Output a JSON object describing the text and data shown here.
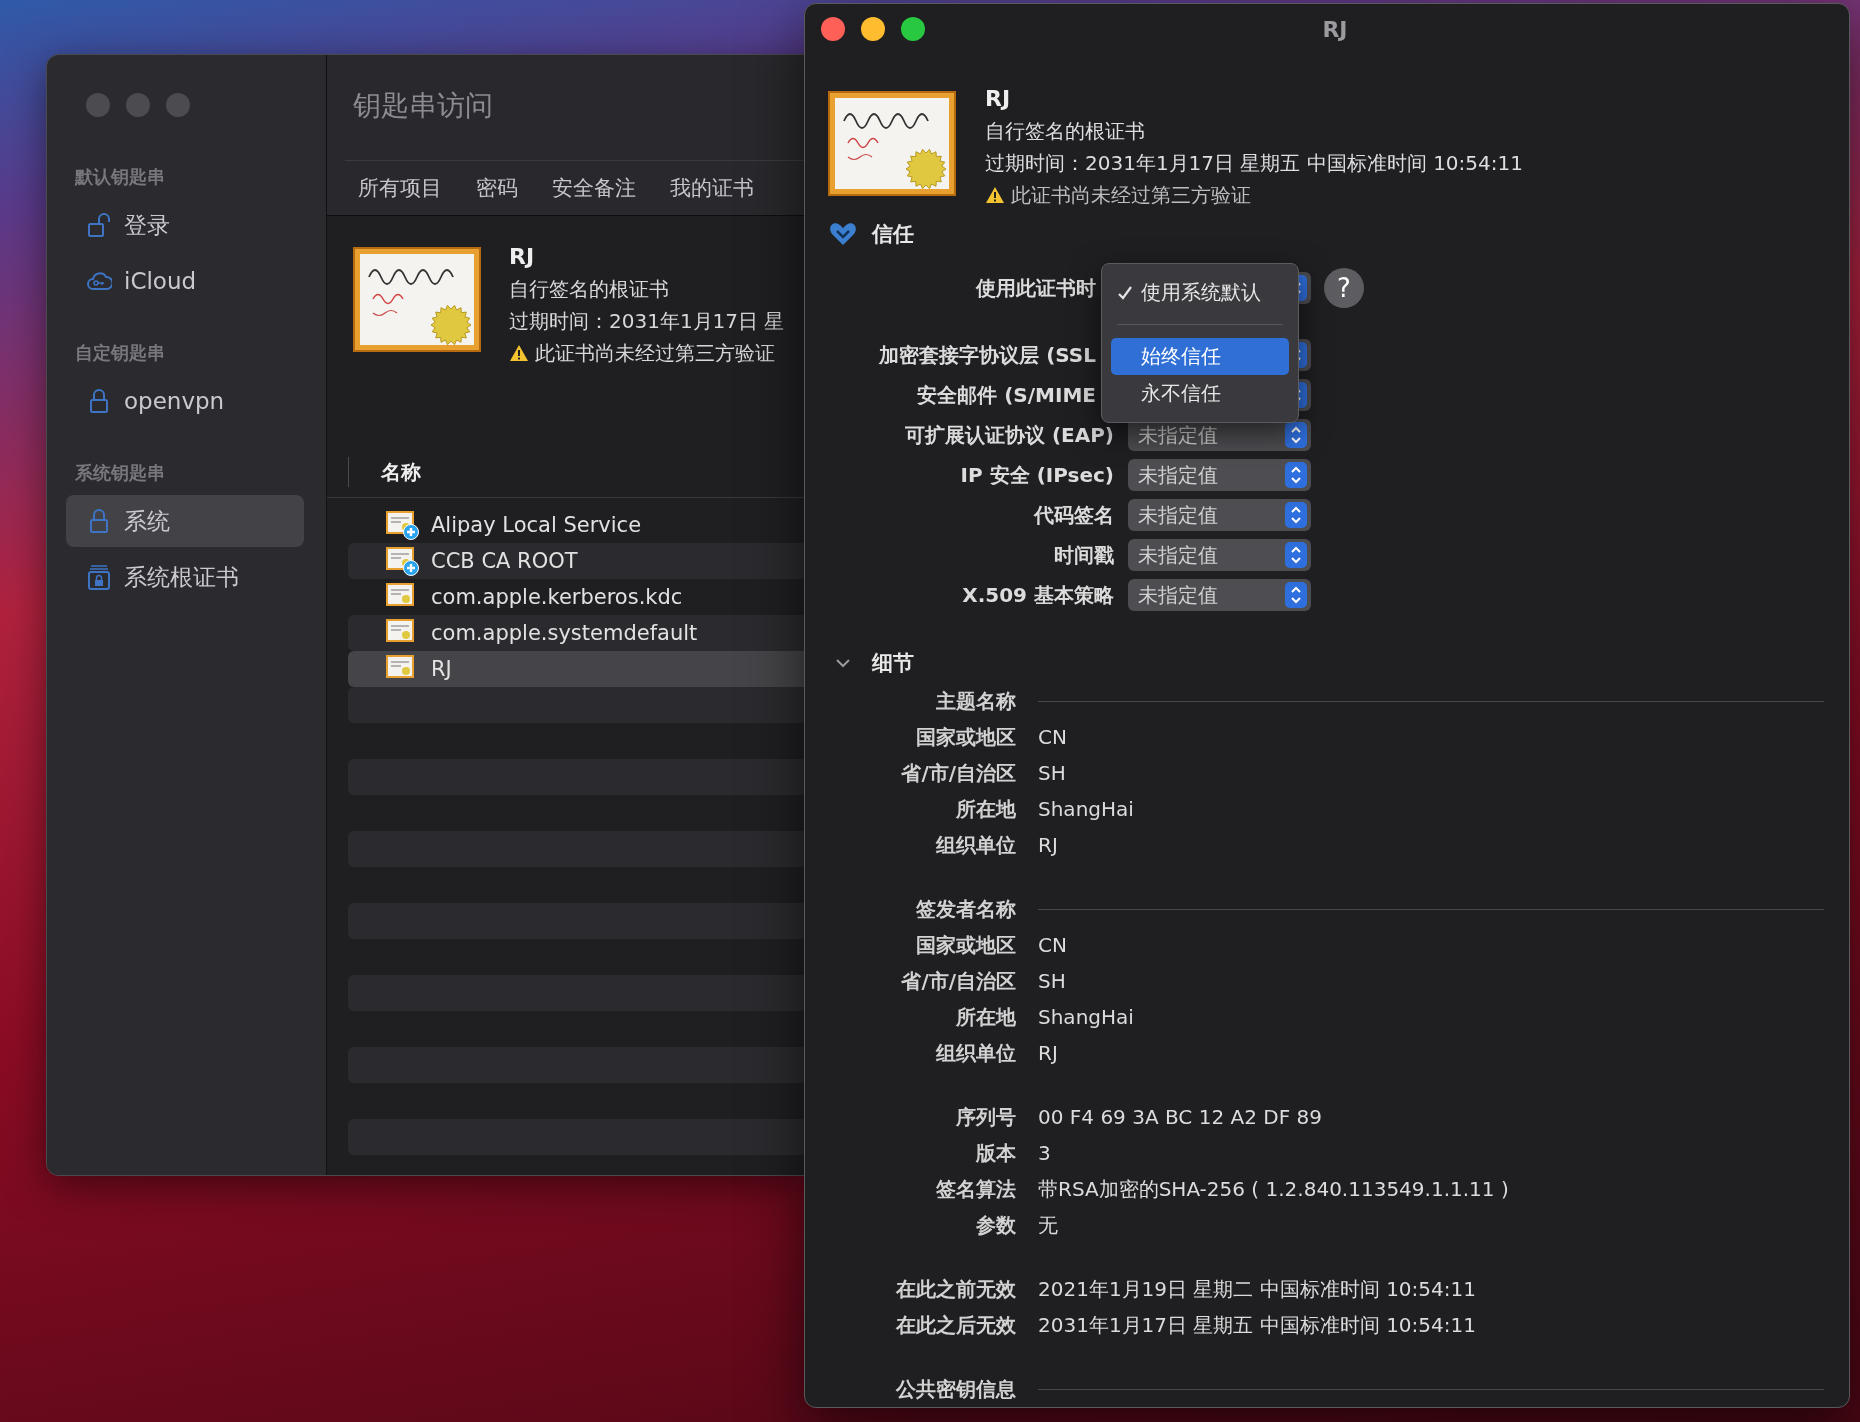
{
  "keychain_window": {
    "title": "钥匙串访问",
    "sidebar": [
      {
        "header": "默认钥匙串",
        "items": [
          {
            "label": "登录",
            "kind": "unlocked",
            "selected": false
          },
          {
            "label": "iCloud",
            "kind": "cloud",
            "selected": false
          }
        ]
      },
      {
        "header": "自定钥匙串",
        "items": [
          {
            "label": "openvpn",
            "kind": "locked",
            "selected": false
          }
        ]
      },
      {
        "header": "系统钥匙串",
        "items": [
          {
            "label": "系统",
            "kind": "locked",
            "selected": true
          },
          {
            "label": "系统根证书",
            "kind": "vault",
            "selected": false
          }
        ]
      }
    ],
    "tabs": [
      {
        "label": "所有项目",
        "selected": false
      },
      {
        "label": "密码",
        "selected": false
      },
      {
        "label": "安全备注",
        "selected": false
      },
      {
        "label": "我的证书",
        "selected": false
      }
    ],
    "summary": {
      "name": "RJ",
      "type": "自行签名的根证书",
      "expires": "过期时间：2031年1月17日 星",
      "warning": "此证书尚未经过第三方验证"
    },
    "table": {
      "columns": [
        "名称"
      ],
      "rows": [
        {
          "name": "Alipay Local Service",
          "kind": "added",
          "selected": false
        },
        {
          "name": "CCB CA ROOT",
          "kind": "added",
          "selected": false
        },
        {
          "name": "com.apple.kerberos.kdc",
          "kind": "plain",
          "selected": false
        },
        {
          "name": "com.apple.systemdefault",
          "kind": "plain",
          "selected": false
        },
        {
          "name": "RJ",
          "kind": "plain",
          "selected": true
        }
      ]
    }
  },
  "certificate_window": {
    "title": "RJ",
    "summary": {
      "name": "RJ",
      "type": "自行签名的根证书",
      "expires": "过期时间：2031年1月17日 星期五 中国标准时间 10:54:11",
      "warning": "此证书尚未经过第三方验证"
    },
    "trust": {
      "heading": "信任",
      "expanded": true,
      "help_button": "?",
      "rows": [
        {
          "label": "使用此证书时"
        },
        {
          "label": "加密套接字协议层 (SSL"
        },
        {
          "label": "安全邮件 (S/MIME"
        },
        {
          "label": "可扩展认证协议 (EAP)",
          "value": "未指定值"
        },
        {
          "label": "IP 安全 (IPsec)",
          "value": "未指定值"
        },
        {
          "label": "代码签名",
          "value": "未指定值"
        },
        {
          "label": "时间戳",
          "value": "未指定值"
        },
        {
          "label": "X.509 基本策略",
          "value": "未指定值"
        }
      ],
      "menu": [
        {
          "kind": "item",
          "label": "使用系统默认",
          "checked": true,
          "selected": false
        },
        {
          "kind": "separator"
        },
        {
          "kind": "item",
          "label": "始终信任",
          "checked": false,
          "selected": true
        },
        {
          "kind": "item",
          "label": "永不信任",
          "checked": false,
          "selected": false
        }
      ]
    },
    "details": {
      "heading": "细节",
      "expanded": true,
      "groups": [
        {
          "header": "主题名称",
          "rows": [
            {
              "label": "国家或地区",
              "value": "CN"
            },
            {
              "label": "省/市/自治区",
              "value": "SH"
            },
            {
              "label": "所在地",
              "value": "ShangHai"
            },
            {
              "label": "组织单位",
              "value": "RJ"
            }
          ]
        },
        {
          "header": "签发者名称",
          "rows": [
            {
              "label": "国家或地区",
              "value": "CN"
            },
            {
              "label": "省/市/自治区",
              "value": "SH"
            },
            {
              "label": "所在地",
              "value": "ShangHai"
            },
            {
              "label": "组织单位",
              "value": "RJ"
            }
          ]
        },
        {
          "rows": [
            {
              "label": "序列号",
              "value": "00 F4 69 3A BC 12 A2 DF 89"
            },
            {
              "label": "版本",
              "value": "3"
            },
            {
              "label": "签名算法",
              "value": "带RSA加密的SHA-256 ( 1.2.840.113549.1.1.11 )"
            },
            {
              "label": "参数",
              "value": "无"
            }
          ]
        },
        {
          "rows": [
            {
              "label": "在此之前无效",
              "value": "2021年1月19日 星期二 中国标准时间 10:54:11"
            },
            {
              "label": "在此之后无效",
              "value": "2031年1月17日 星期五 中国标准时间 10:54:11"
            }
          ]
        },
        {
          "header": "公共密钥信息"
        }
      ]
    }
  }
}
